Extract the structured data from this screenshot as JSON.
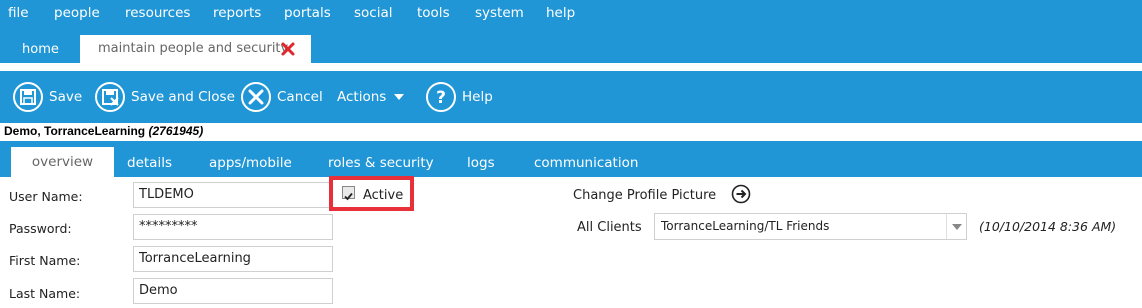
{
  "menu": [
    "file",
    "people",
    "resources",
    "reports",
    "portals",
    "social",
    "tools",
    "system",
    "help"
  ],
  "tabs": {
    "home": "home",
    "maintain": "maintain people and security"
  },
  "toolbar": {
    "save": "Save",
    "save_close": "Save and Close",
    "cancel": "Cancel",
    "actions": "Actions",
    "help": "Help"
  },
  "person": {
    "name": "Demo, TorranceLearning",
    "id": "(2761945)"
  },
  "subtabs": [
    "overview",
    "details",
    "apps/mobile",
    "roles & security",
    "logs",
    "communication"
  ],
  "form": {
    "username_label": "User Name:",
    "username_value": "TLDEMO",
    "password_label": "Password:",
    "password_value": "*********",
    "firstname_label": "First Name:",
    "firstname_value": "TorranceLearning",
    "lastname_label": "Last Name:",
    "lastname_value": "Demo",
    "active_label": "Active",
    "active_checked": true,
    "profile_picture_label": "Change Profile Picture",
    "clients_label": "All Clients",
    "clients_value": "TorranceLearning/TL Friends",
    "timestamp": "(10/10/2014 8:36 AM)"
  },
  "colors": {
    "primary": "#2196d6",
    "highlight": "#e8303a",
    "close": "#e0262c"
  }
}
